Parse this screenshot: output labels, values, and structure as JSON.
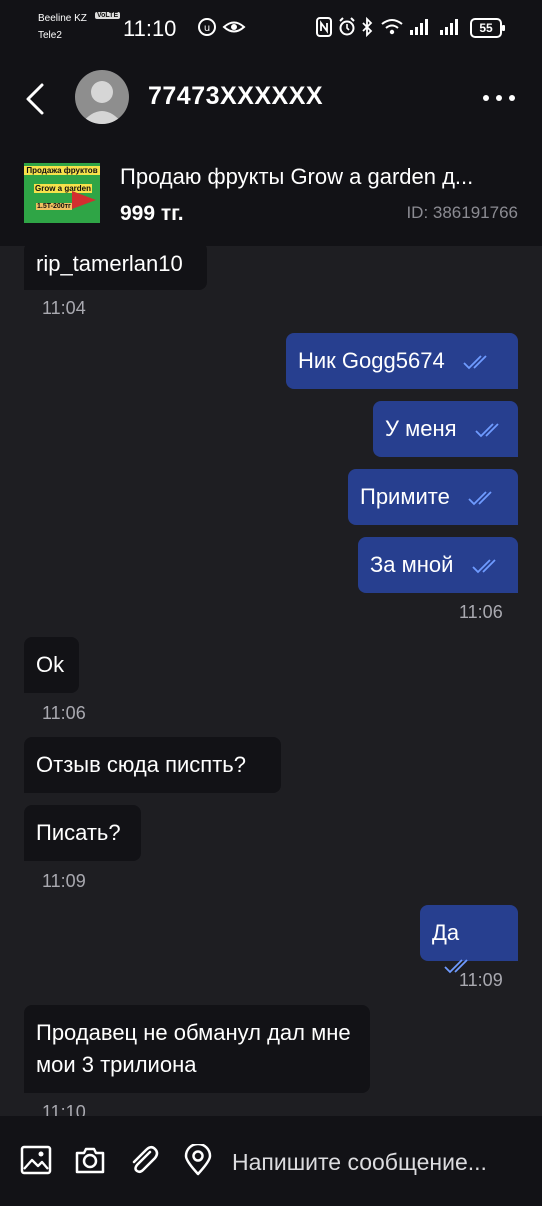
{
  "status": {
    "carrier1": "Beeline KZ",
    "volte": "VoLTE",
    "carrier2": "Tele2",
    "time": "11:10",
    "battery": "55"
  },
  "header": {
    "contact": "77473XXXXXX"
  },
  "listing": {
    "thumb_title": "Продажа фруктов",
    "thumb_sub": "Grow a garden",
    "thumb_price": "1.5T-200тг",
    "title": "Продаю фрукты Grow a garden д...",
    "price": "999 тг.",
    "id": "ID: 386191766"
  },
  "messages": [
    {
      "text": "rip_tamerlan10"
    },
    {
      "time": "11:04"
    },
    {
      "text": "Ник Gogg5674"
    },
    {
      "text": "У меня"
    },
    {
      "text": "Примите"
    },
    {
      "text": "За мной"
    },
    {
      "time": "11:06"
    },
    {
      "text": "Ok"
    },
    {
      "time": "11:06"
    },
    {
      "text": "Отзыв сюда писпть?"
    },
    {
      "text": "Писать?"
    },
    {
      "time": "11:09"
    },
    {
      "text": "Да"
    },
    {
      "time": "11:09"
    },
    {
      "text": "Продавец не обманул дал мне мои 3 трилиона"
    },
    {
      "time": "11:10"
    }
  ],
  "composer": {
    "placeholder": "Напишите сообщение..."
  },
  "colors": {
    "background": "#1e1e22",
    "incoming": "#121216",
    "outgoing": "#273f8f",
    "ticks": "#6f9bff"
  }
}
